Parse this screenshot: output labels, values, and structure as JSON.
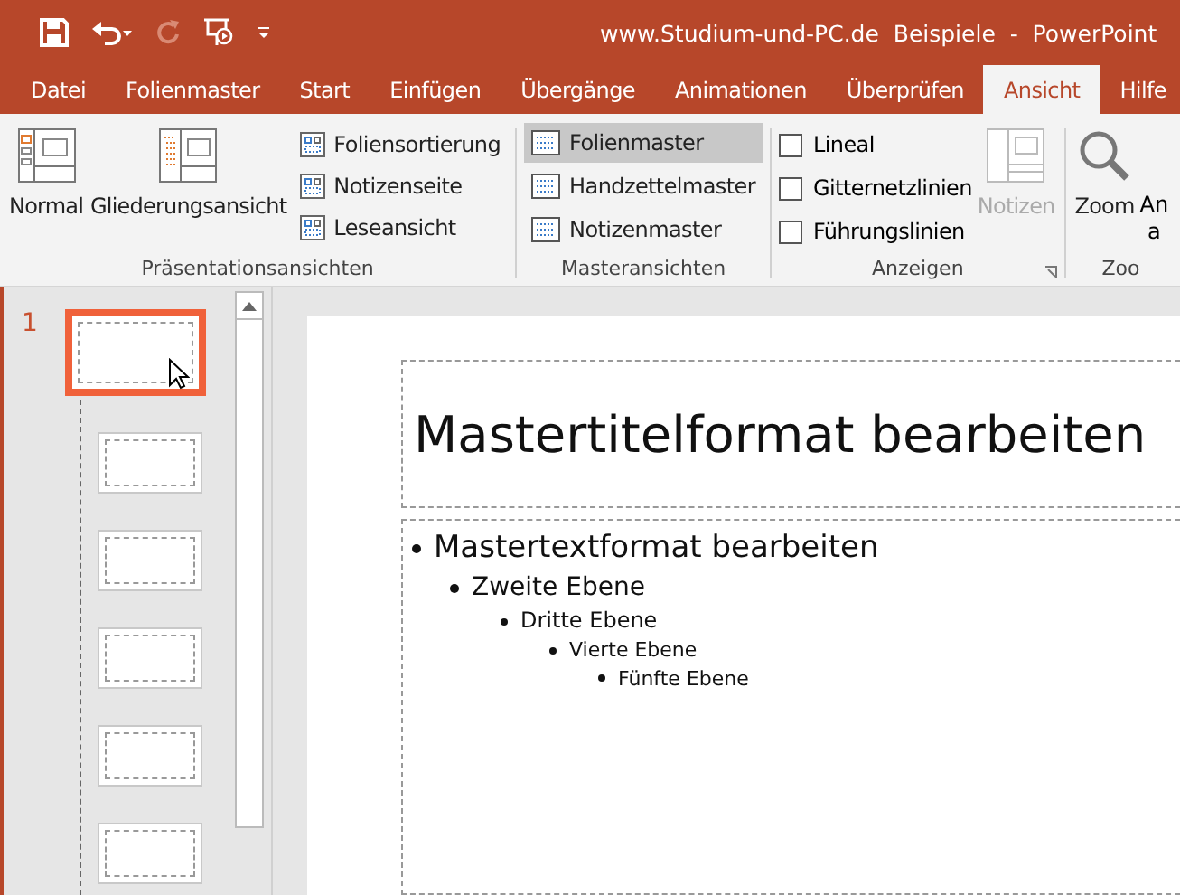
{
  "window": {
    "title": "www.Studium-und-PC.de  Beispiele  -  PowerPoint"
  },
  "tabs": [
    {
      "label": "Datei",
      "selected": false
    },
    {
      "label": "Folienmaster",
      "selected": false
    },
    {
      "label": "Start",
      "selected": false
    },
    {
      "label": "Einfügen",
      "selected": false
    },
    {
      "label": "Übergänge",
      "selected": false
    },
    {
      "label": "Animationen",
      "selected": false
    },
    {
      "label": "Überprüfen",
      "selected": false
    },
    {
      "label": "Ansicht",
      "selected": true
    },
    {
      "label": "Hilfe",
      "selected": false
    }
  ],
  "ribbon": {
    "presentation_views": {
      "label": "Präsentationsansichten",
      "large": [
        "Normal",
        "Gliederungsansicht"
      ],
      "small": [
        {
          "label": "Foliensortierung",
          "selected": false
        },
        {
          "label": "Notizenseite",
          "selected": false
        },
        {
          "label": "Leseansicht",
          "selected": false
        }
      ]
    },
    "master_views": {
      "label": "Masteransichten",
      "items": [
        {
          "label": "Folienmaster",
          "selected": true
        },
        {
          "label": "Handzettelmaster",
          "selected": false
        },
        {
          "label": "Notizenmaster",
          "selected": false
        }
      ]
    },
    "show": {
      "label": "Anzeigen",
      "checkboxes": [
        {
          "label": "Lineal",
          "checked": false
        },
        {
          "label": "Gitternetzlinien",
          "checked": false
        },
        {
          "label": "Führungslinien",
          "checked": false
        }
      ],
      "notes": {
        "label": "Notizen",
        "disabled": true
      }
    },
    "zoom": {
      "label": "Zoo",
      "zoom_button": "Zoom",
      "fit_button": [
        "An",
        "a"
      ]
    }
  },
  "thumbnails": [
    {
      "number": "1",
      "selected": true
    },
    {
      "selected": false
    },
    {
      "selected": false
    },
    {
      "selected": false
    },
    {
      "selected": false
    },
    {
      "selected": false
    }
  ],
  "slide": {
    "title": "Mastertitelformat bearbeiten",
    "levels": [
      "Mastertextformat bearbeiten",
      "Zweite Ebene",
      "Dritte Ebene",
      "Vierte Ebene",
      "Fünfte Ebene"
    ]
  }
}
